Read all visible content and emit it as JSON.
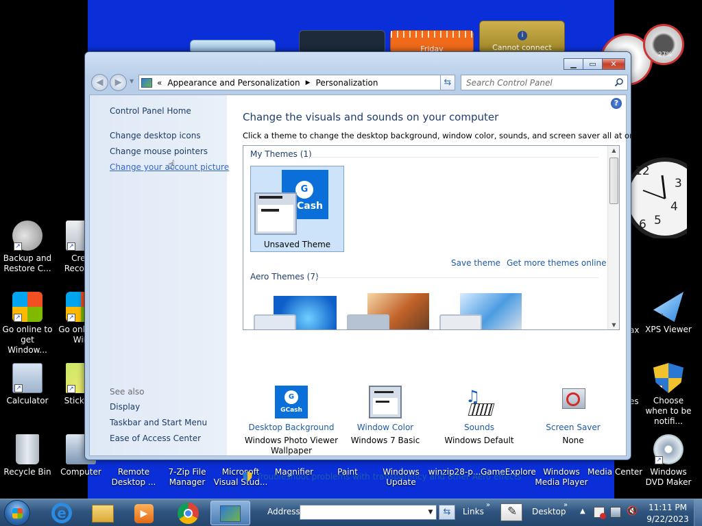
{
  "desktop": {
    "left_icons": [
      {
        "label": "Backup and Restore C...",
        "icon": "backup-restore-icon"
      },
      {
        "label": "Go online to get Window...",
        "icon": "windows-logo-icon"
      },
      {
        "label": "Calculator",
        "icon": "calculator-icon"
      },
      {
        "label": "Recycle Bin",
        "icon": "recycle-bin-icon"
      }
    ],
    "second_col_icons": [
      {
        "label": "Crea Recover",
        "icon": "create-recovery-icon"
      },
      {
        "label": "Go onli get Win",
        "icon": "windows-logo-icon"
      },
      {
        "label": "Sticky N",
        "icon": "sticky-notes-icon"
      },
      {
        "label": "Computer",
        "icon": "computer-icon"
      }
    ],
    "bottom_row": [
      {
        "label": "Remote Desktop ...",
        "icon": "remote-desktop-icon"
      },
      {
        "label": "7-Zip File Manager",
        "icon": "7zip-icon"
      },
      {
        "label": "Microsoft Visual Stud...",
        "icon": "visual-studio-icon"
      },
      {
        "label": "Magnifier",
        "icon": "magnifier-icon"
      },
      {
        "label": "Paint",
        "icon": "paint-icon"
      },
      {
        "label": "Windows Update",
        "icon": "windows-update-icon"
      },
      {
        "label": "winzip28-p...",
        "icon": "winzip-icon"
      },
      {
        "label": "GameExplorer",
        "icon": "game-explorer-icon"
      },
      {
        "label": "Windows Media Player",
        "icon": "media-player-icon"
      },
      {
        "label": "Media Center",
        "icon": "media-center-icon"
      }
    ],
    "right_icons": [
      {
        "label": "XPS Viewer",
        "icon": "xps-viewer-icon"
      },
      {
        "label": "Choose when to be notifi...",
        "icon": "uac-shield-icon"
      },
      {
        "label": "Windows DVD Maker",
        "icon": "dvd-maker-icon"
      }
    ],
    "partial_labels": {
      "ax": "ax",
      "es": "es"
    },
    "gadgets": {
      "calendar_day": "Friday",
      "weather_status": "Cannot connect",
      "meter_percent": "27%",
      "clock_numbers": [
        "12",
        "3",
        "4",
        "5",
        "6"
      ]
    }
  },
  "window": {
    "breadcrumb_root": "«",
    "breadcrumb": [
      "Appearance and Personalization",
      "Personalization"
    ],
    "search_placeholder": "Search Control Panel",
    "sidebar": {
      "home": "Control Panel Home",
      "links": [
        "Change desktop icons",
        "Change mouse pointers",
        "Change your account picture"
      ],
      "see_also_title": "See also",
      "see_also": [
        "Display",
        "Taskbar and Start Menu",
        "Ease of Access Center"
      ]
    },
    "main": {
      "title": "Change the visuals and sounds on your computer",
      "description": "Click a theme to change the desktop background, window color, sounds, and screen saver all at once.",
      "my_themes_title": "My Themes (1)",
      "unsaved_theme_label": "Unsaved Theme",
      "unsaved_theme_brand": "Cash",
      "save_theme": "Save theme",
      "get_more_themes": "Get more themes online",
      "aero_themes_title": "Aero Themes (7)"
    },
    "settings": [
      {
        "link": "Desktop Background",
        "value": "Windows Photo Viewer Wallpaper",
        "icon": "gcash-wallpaper-icon",
        "icon_text": "GCash"
      },
      {
        "link": "Window Color",
        "value": "Windows 7 Basic",
        "icon": "window-color-icon"
      },
      {
        "link": "Sounds",
        "value": "Windows Default",
        "icon": "sounds-icon"
      },
      {
        "link": "Screen Saver",
        "value": "None",
        "icon": "screen-saver-icon"
      }
    ],
    "troubleshoot_link": "Troubleshoot problems with transparency and other Aero effects"
  },
  "taskbar": {
    "address_label": "Address",
    "links_label": "Links",
    "desktop_label": "Desktop",
    "time": "11:11 PM",
    "date": "9/22/2023",
    "pinned": [
      "internet-explorer-icon",
      "explorer-folder-icon",
      "media-player-icon",
      "chrome-icon",
      "control-panel-icon"
    ]
  },
  "colors": {
    "desktop_blue": "#0a2fd8",
    "link_blue": "#1e5aa8",
    "title_blue": "#1e3d6c"
  }
}
